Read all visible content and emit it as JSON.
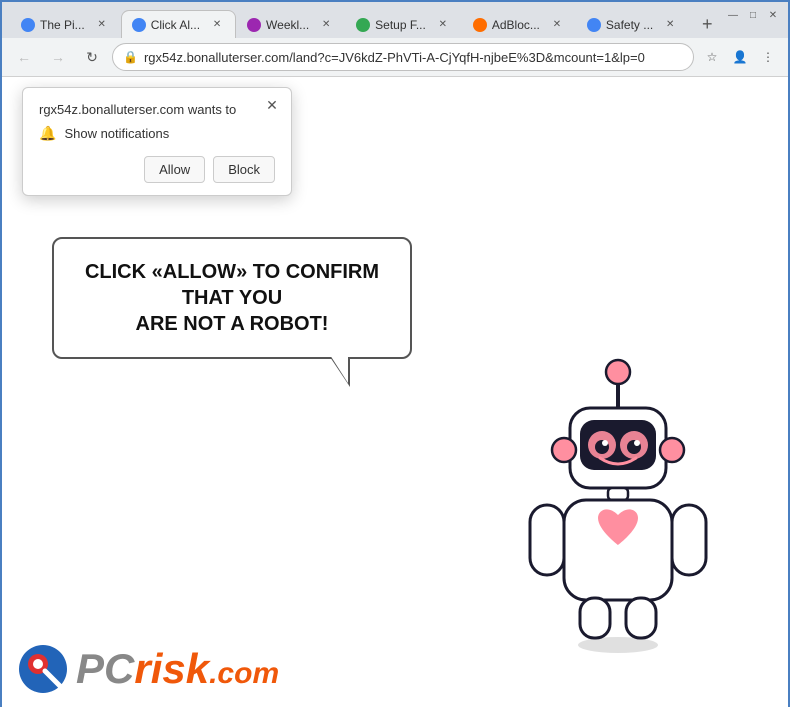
{
  "browser": {
    "window_controls": {
      "minimize": "—",
      "maximize": "□",
      "close": "✕"
    },
    "tabs": [
      {
        "id": "tab1",
        "label": "The Pi...",
        "icon_color": "blue",
        "active": false
      },
      {
        "id": "tab2",
        "label": "Click Al...",
        "icon_color": "blue",
        "active": true
      },
      {
        "id": "tab3",
        "label": "Weekl...",
        "icon_color": "purple",
        "active": false
      },
      {
        "id": "tab4",
        "label": "Setup F...",
        "icon_color": "green",
        "active": false
      },
      {
        "id": "tab5",
        "label": "AdBloc...",
        "icon_color": "orange",
        "active": false
      },
      {
        "id": "tab6",
        "label": "Safety ...",
        "icon_color": "blue",
        "active": false
      }
    ],
    "new_tab_label": "+",
    "address_bar": {
      "url": "rgx54z.bonalluterser.com/land?c=JV6kdZ-PhVTi-A-CjYqfH-njbeE%3D&mcount=1&lp=0",
      "lock_icon": "🔒"
    },
    "nav": {
      "back": "←",
      "forward": "→",
      "reload": "↻"
    }
  },
  "notification_popup": {
    "site": "rgx54z.bonalluterser.com wants to",
    "notification_text": "Show notifications",
    "allow_label": "Allow",
    "block_label": "Block",
    "close_icon": "✕"
  },
  "page": {
    "bubble_text_line1": "CLICK «ALLOW» TO CONFIRM THAT YOU",
    "bubble_text_line2": "ARE NOT A ROBOT!"
  },
  "logo": {
    "pc_text": "PC",
    "risk_text": "risk",
    "dot_com": ".com"
  }
}
